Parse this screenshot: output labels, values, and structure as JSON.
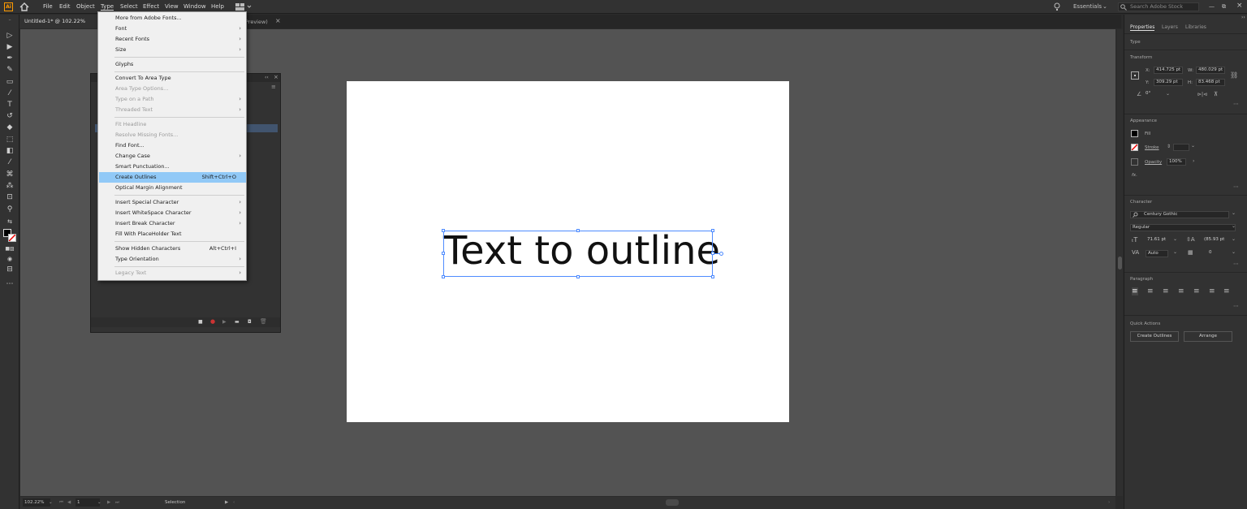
{
  "menubar": {
    "logo": "Ai",
    "items": [
      "File",
      "Edit",
      "Object",
      "Type",
      "Select",
      "Effect",
      "View",
      "Window",
      "Help"
    ],
    "workspace": "Essentials",
    "search_placeholder": "Search Adobe Stock"
  },
  "doc_tab": {
    "title": "Untitled-1* @ 102.22% (CMY",
    "title_tail": "Preview)",
    "close": "×"
  },
  "type_menu": {
    "items": [
      {
        "label": "More from Adobe Fonts...",
        "disabled": false,
        "submenu": false
      },
      {
        "label": "Font",
        "disabled": false,
        "submenu": true
      },
      {
        "label": "Recent Fonts",
        "disabled": false,
        "submenu": true
      },
      {
        "label": "Size",
        "disabled": false,
        "submenu": true
      },
      {
        "label": "Glyphs",
        "disabled": false,
        "submenu": false
      },
      {
        "label": "Convert To Area Type",
        "disabled": false,
        "submenu": false
      },
      {
        "label": "Area Type Options...",
        "disabled": true,
        "submenu": false
      },
      {
        "label": "Type on a Path",
        "disabled": true,
        "submenu": true
      },
      {
        "label": "Threaded Text",
        "disabled": true,
        "submenu": true
      },
      {
        "label": "Fit Headline",
        "disabled": true,
        "submenu": false
      },
      {
        "label": "Resolve Missing Fonts...",
        "disabled": true,
        "submenu": false
      },
      {
        "label": "Find Font...",
        "disabled": false,
        "submenu": false
      },
      {
        "label": "Change Case",
        "disabled": false,
        "submenu": true
      },
      {
        "label": "Smart Punctuation...",
        "disabled": false,
        "submenu": false
      },
      {
        "label": "Create Outlines",
        "disabled": false,
        "submenu": false,
        "shortcut": "Shift+Ctrl+O",
        "highlighted": true
      },
      {
        "label": "Optical Margin Alignment",
        "disabled": false,
        "submenu": false
      },
      {
        "label": "Insert Special Character",
        "disabled": false,
        "submenu": true
      },
      {
        "label": "Insert WhiteSpace Character",
        "disabled": false,
        "submenu": true
      },
      {
        "label": "Insert Break Character",
        "disabled": false,
        "submenu": true
      },
      {
        "label": "Fill With PlaceHolder Text",
        "disabled": false,
        "submenu": false
      },
      {
        "label": "Show Hidden Characters",
        "disabled": false,
        "submenu": false,
        "shortcut": "Alt+Ctrl+I"
      },
      {
        "label": "Type Orientation",
        "disabled": false,
        "submenu": true
      },
      {
        "label": "Legacy Text",
        "disabled": true,
        "submenu": true
      }
    ]
  },
  "artboard": {
    "text": "Text to outline"
  },
  "properties": {
    "tabs": [
      "Properties",
      "Layers",
      "Libraries"
    ],
    "type_label": "Type",
    "transform": {
      "title": "Transform",
      "x_label": "X:",
      "x": "414.725 pt",
      "y_label": "Y:",
      "y": "309.29 pt",
      "w_label": "W:",
      "w": "480.029 pt",
      "h_label": "H:",
      "h": "83.468 pt",
      "angle": "0°"
    },
    "appearance": {
      "title": "Appearance",
      "fill": "Fill",
      "stroke": "Stroke",
      "opacity_label": "Opacity",
      "opacity": "100%",
      "fx": "fx."
    },
    "character": {
      "title": "Character",
      "font": "Century Gothic",
      "style": "Regular",
      "size": "71.61 pt",
      "leading": "(85.93 pt",
      "kerning": "Auto",
      "tracking": "0"
    },
    "paragraph": {
      "title": "Paragraph"
    },
    "quick_actions": {
      "title": "Quick Actions",
      "create_outlines": "Create Outlines",
      "arrange": "Arrange"
    }
  },
  "statusbar": {
    "zoom": "102.22%",
    "artboard_num": "1",
    "tool": "Selection"
  },
  "colors": {
    "accent": "#4f8cff",
    "menu_highlight": "#91c9f7",
    "logo": "#ff9a00"
  }
}
